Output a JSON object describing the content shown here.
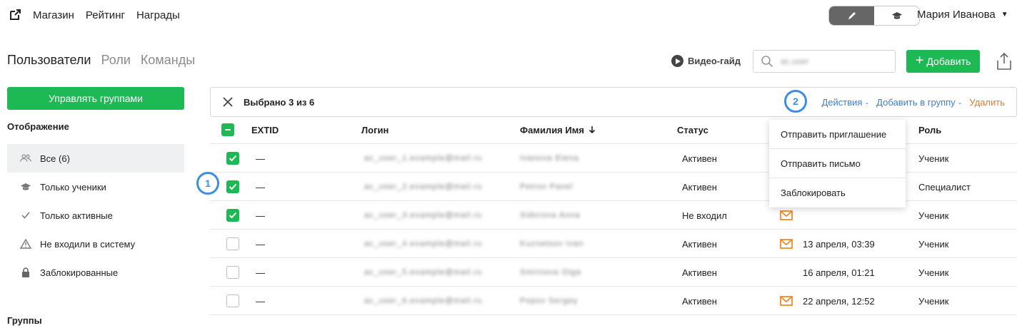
{
  "topnav": {
    "icon": "external-link-icon",
    "links": [
      "Магазин",
      "Рейтинг",
      "Награды"
    ]
  },
  "mode_toggle": {
    "left_icon": "pencil-icon",
    "right_icon": "graduation-cap-icon",
    "active": "left"
  },
  "user": {
    "name": "Мария Иванова"
  },
  "tabs": [
    {
      "label": "Пользователи",
      "active": true
    },
    {
      "label": "Роли",
      "active": false
    },
    {
      "label": "Команды",
      "active": false
    }
  ],
  "toolbar": {
    "video_guide": "Видео-гайд",
    "search_value": "ac.user",
    "add_label": "Добавить"
  },
  "sidebar": {
    "manage_groups": "Управлять группами",
    "display_title": "Отображение",
    "filters": [
      {
        "label": "Все (6)",
        "icon": "users-icon",
        "active": true
      },
      {
        "label": "Только ученики",
        "icon": "graduation-cap-icon",
        "active": false
      },
      {
        "label": "Только активные",
        "icon": "check-icon",
        "active": false
      },
      {
        "label": "Не входили в систему",
        "icon": "warning-icon",
        "active": false
      },
      {
        "label": "Заблокированные",
        "icon": "lock-icon",
        "active": false
      }
    ],
    "groups_title": "Группы"
  },
  "selection": {
    "text": "Выбрано 3 из 6",
    "actions": "Действия",
    "add_to_group": "Добавить в группу",
    "delete": "Удалить"
  },
  "badges": {
    "one": "1",
    "two": "2"
  },
  "table": {
    "headers": {
      "extid": "EXTID",
      "login": "Логин",
      "name": "Фамилия Имя",
      "status": "Статус",
      "role": "Роль"
    },
    "rows": [
      {
        "checked": true,
        "extid": "—",
        "login": "ac_user_1.example@mail.ru",
        "name": "Ivanova Elena",
        "status": "Активен",
        "mail": false,
        "last": "",
        "role": "Ученик"
      },
      {
        "checked": true,
        "extid": "—",
        "login": "ac_user_2.example@mail.ru",
        "name": "Petrov Pavel",
        "status": "Активен",
        "mail": false,
        "last": "",
        "role": "Специалист"
      },
      {
        "checked": true,
        "extid": "—",
        "login": "ac_user_3.example@mail.ru",
        "name": "Sidorova Anna",
        "status": "Не входил",
        "mail": true,
        "last": "",
        "role": "Ученик"
      },
      {
        "checked": false,
        "extid": "—",
        "login": "ac_user_4.example@mail.ru",
        "name": "Kuznetsov Ivan",
        "status": "Активен",
        "mail": true,
        "last": "13 апреля, 03:39",
        "role": "Ученик"
      },
      {
        "checked": false,
        "extid": "—",
        "login": "ac_user_5.example@mail.ru",
        "name": "Smirnova Olga",
        "status": "Активен",
        "mail": false,
        "last": "16 апреля, 01:21",
        "role": "Ученик"
      },
      {
        "checked": false,
        "extid": "—",
        "login": "ac_user_6.example@mail.ru",
        "name": "Popov Sergey",
        "status": "Активен",
        "mail": true,
        "last": "22 апреля, 12:52",
        "role": "Ученик"
      }
    ]
  },
  "actions_menu": [
    "Отправить приглашение",
    "Отправить письмо",
    "Заблокировать"
  ],
  "colors": {
    "accent_green": "#1db954",
    "link_blue": "#3a7fd5",
    "danger_orange": "#e8782c",
    "badge_blue": "#3a8ee6"
  }
}
